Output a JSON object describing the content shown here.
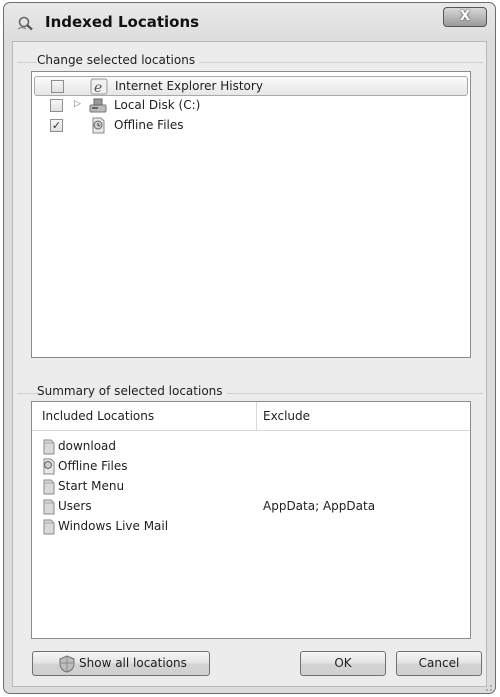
{
  "window": {
    "title": "Indexed Locations",
    "close_label": "X"
  },
  "change_group": {
    "label": "Change selected locations",
    "items": [
      {
        "label": "Internet Explorer History",
        "checked": false,
        "expandable": false,
        "selected": true,
        "icon": "ie-history-icon"
      },
      {
        "label": "Local Disk (C:)",
        "checked": false,
        "expandable": true,
        "selected": false,
        "icon": "local-disk-icon"
      },
      {
        "label": "Offline Files",
        "checked": true,
        "expandable": false,
        "selected": false,
        "icon": "offline-files-icon"
      }
    ],
    "check_glyph": "✓",
    "expander_glyph": "▷"
  },
  "summary_group": {
    "label": "Summary of selected locations",
    "columns": [
      "Included Locations",
      "Exclude"
    ],
    "rows": [
      {
        "location": "download",
        "exclude": "",
        "icon": "folder-icon"
      },
      {
        "location": "Offline Files",
        "exclude": "",
        "icon": "offline-files-icon"
      },
      {
        "location": "Start Menu",
        "exclude": "",
        "icon": "folder-icon"
      },
      {
        "location": "Users",
        "exclude": "AppData; AppData",
        "icon": "folder-icon"
      },
      {
        "location": "Windows Live Mail",
        "exclude": "",
        "icon": "folder-icon"
      }
    ]
  },
  "buttons": {
    "show_all": "Show all locations",
    "ok": "OK",
    "cancel": "Cancel"
  },
  "colors": {
    "window_bg": "#ececec",
    "selection_border": "#a9a9a9"
  }
}
